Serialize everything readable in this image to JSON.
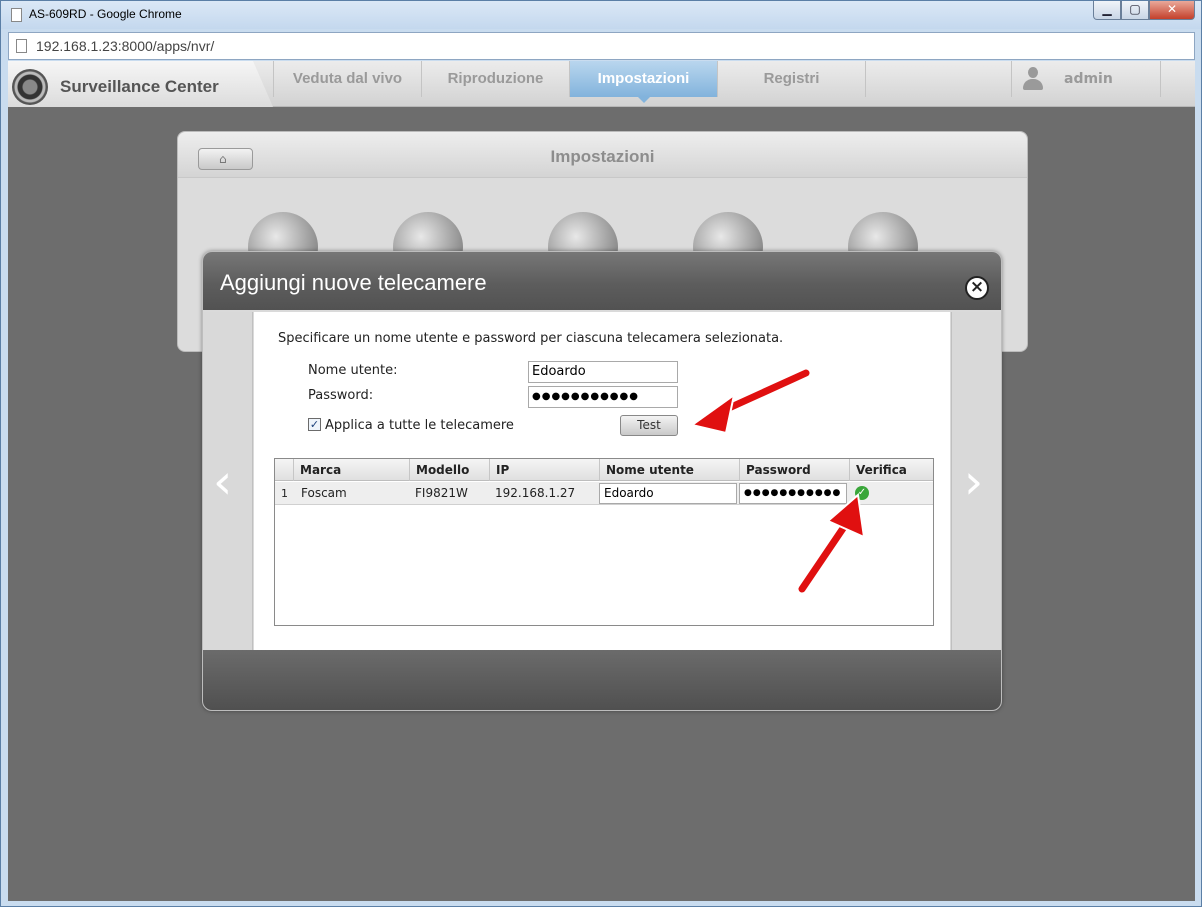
{
  "browser": {
    "window_title": "AS-609RD - Google Chrome",
    "url": "192.168.1.23:8000/apps/nvr/",
    "min_glyph": "▁",
    "max_glyph": "▢",
    "close_glyph": "✕"
  },
  "app": {
    "brand": "Surveillance Center",
    "tabs": [
      {
        "label": "Veduta dal vivo"
      },
      {
        "label": "Riproduzione"
      },
      {
        "label": "Impostazioni"
      },
      {
        "label": "Registri"
      }
    ],
    "active_tab": "Impostazioni",
    "user": "admin"
  },
  "settings_panel": {
    "title": "Impostazioni"
  },
  "modal": {
    "title": "Aggiungi nuove telecamere",
    "close_glyph": "×",
    "prev_glyph": "‹",
    "next_glyph": "›",
    "instruction": "Specificare un nome utente e password per ciascuna telecamera selezionata.",
    "username_label": "Nome utente:",
    "username_value": "Edoardo",
    "password_label": "Password:",
    "password_value": "●●●●●●●●●●●",
    "apply_all_label": "Applica a tutte le telecamere",
    "apply_all_checked": true,
    "check_glyph": "✓",
    "test_button": "Test",
    "table": {
      "columns": [
        "Marca",
        "Modello",
        "IP",
        "Nome utente",
        "Password",
        "Verifica"
      ],
      "rows": [
        {
          "index": "1",
          "marca": "Foscam",
          "modello": "FI9821W",
          "ip": "192.168.1.27",
          "nome_utente": "Edoardo",
          "password": "●●●●●●●●●●●",
          "verifica": "ok"
        }
      ]
    }
  },
  "colors": {
    "active_tab": "#82b3dc",
    "verify_ok": "#3aa63a",
    "annotation_arrow": "#e01010"
  }
}
